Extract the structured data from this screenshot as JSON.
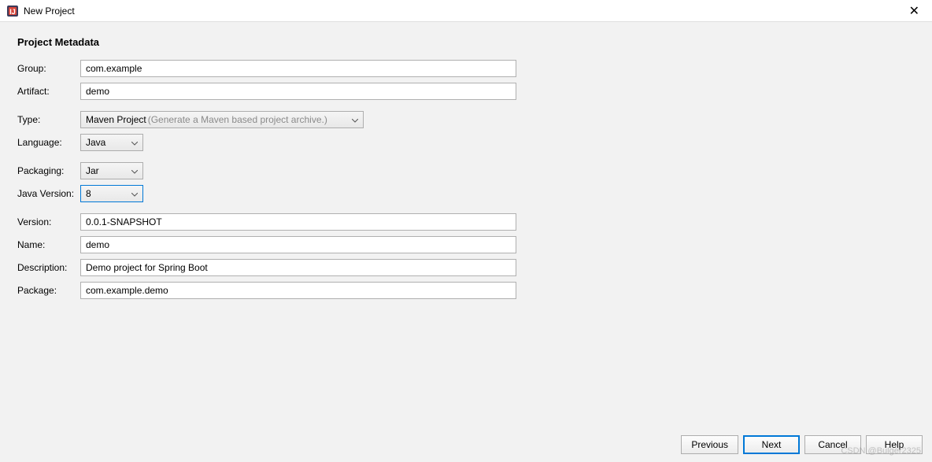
{
  "window": {
    "title": "New Project"
  },
  "section": {
    "title": "Project Metadata"
  },
  "form": {
    "group": {
      "label": "Group:",
      "value": "com.example"
    },
    "artifact": {
      "label": "Artifact:",
      "value": "demo"
    },
    "type": {
      "label": "Type:",
      "value": "Maven Project",
      "hint": "(Generate a Maven based project archive.)"
    },
    "language": {
      "label": "Language:",
      "value": "Java"
    },
    "packaging": {
      "label": "Packaging:",
      "value": "Jar"
    },
    "javaVersion": {
      "label": "Java Version:",
      "value": "8"
    },
    "version": {
      "label": "Version:",
      "value": "0.0.1-SNAPSHOT"
    },
    "name": {
      "label": "Name:",
      "value": "demo"
    },
    "description": {
      "label": "Description:",
      "value": "Demo project for Spring Boot"
    },
    "package": {
      "label": "Package:",
      "value": "com.example.demo"
    }
  },
  "buttons": {
    "previous": "Previous",
    "next": "Next",
    "cancel": "Cancel",
    "help": "Help"
  },
  "watermark": "CSDN @Bulger2325"
}
